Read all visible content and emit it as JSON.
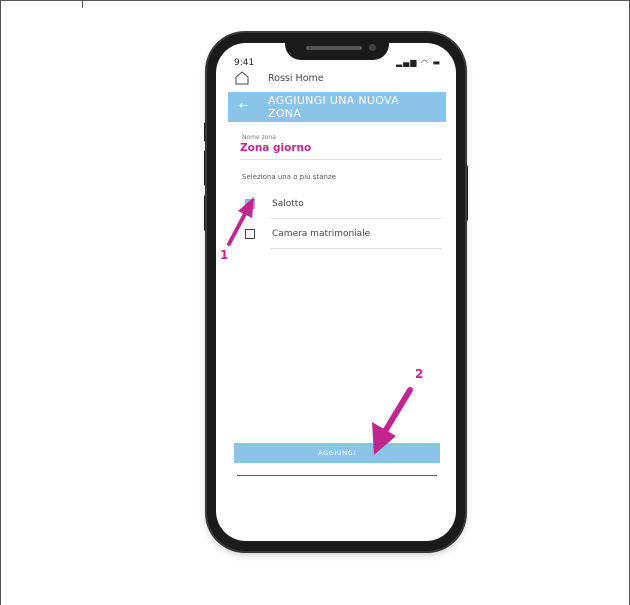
{
  "status_bar": {
    "time": "9:41",
    "icons_text": "▂▄▆ ◠ ▬"
  },
  "header": {
    "home_title": "Rossi Home",
    "title": "AGGIUNGI UNA NUOVA ZONA",
    "back_icon": "arrow-left-icon"
  },
  "zone": {
    "label": "Nome zona",
    "value": "Zona giorno"
  },
  "rooms": {
    "prompt": "Seleziona una o più stanze",
    "items": [
      {
        "label": "Salotto",
        "checked": true
      },
      {
        "label": "Camera matrimoniale",
        "checked": false
      }
    ]
  },
  "actions": {
    "add_label": "AGGIUNGI"
  },
  "annotations": {
    "marker_1": "1",
    "marker_2": "2"
  },
  "colors": {
    "accent": "#8ac4e8",
    "annotation": "#c0268e",
    "zone_value": "#c0268e"
  }
}
